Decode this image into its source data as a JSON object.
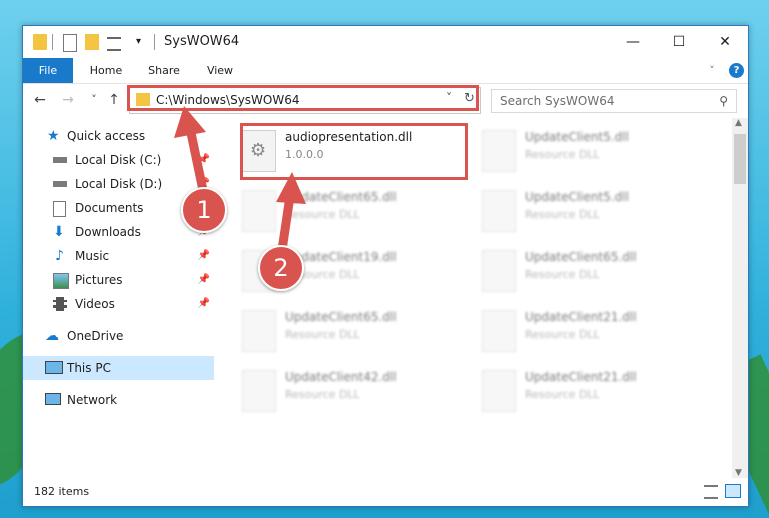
{
  "window": {
    "title": "SysWOW64",
    "minimize": "—",
    "maximize": "☐",
    "close": "✕"
  },
  "ribbon": {
    "tabs": [
      "File",
      "Home",
      "Share",
      "View"
    ],
    "help": "?"
  },
  "nav": {
    "back": "←",
    "forward": "→",
    "recent": "˅",
    "up": "↑"
  },
  "address": {
    "path": "C:\\Windows\\SysWOW64",
    "dropdown": "˅",
    "refresh": "↻"
  },
  "search": {
    "placeholder": "Search SysWOW64"
  },
  "sidebar": {
    "quick_access": "Quick access",
    "items": [
      {
        "label": "Local Disk (C:)",
        "icon": "drive-icon",
        "pinned": true
      },
      {
        "label": "Local Disk (D:)",
        "icon": "drive-icon",
        "pinned": true
      },
      {
        "label": "Documents",
        "icon": "documents-icon",
        "pinned": true
      },
      {
        "label": "Downloads",
        "icon": "downloads-icon",
        "pinned": true
      },
      {
        "label": "Music",
        "icon": "music-icon",
        "pinned": true
      },
      {
        "label": "Pictures",
        "icon": "pictures-icon",
        "pinned": true
      },
      {
        "label": "Videos",
        "icon": "videos-icon",
        "pinned": true
      }
    ],
    "onedrive": "OneDrive",
    "thispc": "This PC",
    "network": "Network",
    "pin_glyph": "📌"
  },
  "files": [
    {
      "name": "audiopresentation.dll",
      "sub": "1.0.0.0",
      "highlight": true
    },
    {
      "name": "UpdateClient5.dll",
      "sub": "Resource DLL"
    },
    {
      "name": "UpdateClient65.dll",
      "sub": "Resource DLL"
    },
    {
      "name": "UpdateClient5.dll",
      "sub": "Resource DLL"
    },
    {
      "name": "UpdateClient19.dll",
      "sub": "Resource DLL"
    },
    {
      "name": "UpdateClient65.dll",
      "sub": "Resource DLL"
    },
    {
      "name": "UpdateClient65.dll",
      "sub": "Resource DLL"
    },
    {
      "name": "UpdateClient21.dll",
      "sub": "Resource DLL"
    },
    {
      "name": "UpdateClient42.dll",
      "sub": "Resource DLL"
    },
    {
      "name": "UpdateClient21.dll",
      "sub": "Resource DLL"
    }
  ],
  "status": {
    "count": "182 items"
  },
  "annotations": {
    "step1": "1",
    "step2": "2"
  },
  "colors": {
    "accent": "#1979ca",
    "highlight": "#d9534f",
    "selected": "#cce8ff"
  }
}
